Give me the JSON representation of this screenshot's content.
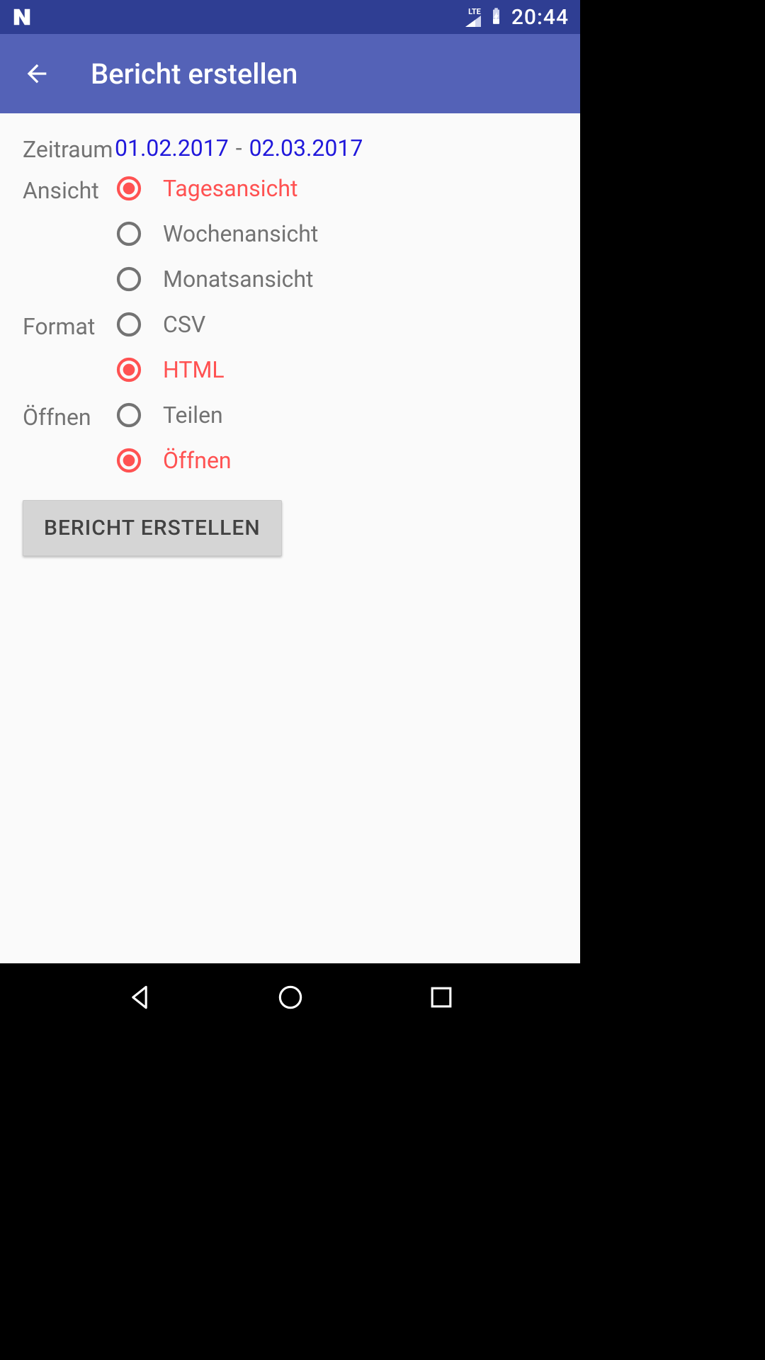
{
  "status": {
    "time": "20:44",
    "network_label": "LTE"
  },
  "appbar": {
    "title": "Bericht erstellen"
  },
  "form": {
    "zeitraum_label": "Zeitraum",
    "date_from": "01.02.2017",
    "date_sep": "-",
    "date_to": "02.03.2017",
    "ansicht_label": "Ansicht",
    "ansicht_options": {
      "tag": "Tagesansicht",
      "woche": "Wochenansicht",
      "monat": "Monatsansicht"
    },
    "ansicht_selected": "tag",
    "format_label": "Format",
    "format_options": {
      "csv": "CSV",
      "html": "HTML"
    },
    "format_selected": "html",
    "offnen_label": "Öffnen",
    "offnen_options": {
      "teilen": "Teilen",
      "offnen": "Öffnen"
    },
    "offnen_selected": "offnen",
    "submit_label": "BERICHT ERSTELLEN"
  },
  "colors": {
    "accent": "#ff5252",
    "link": "#2018db",
    "appbar_bg": "#5462b7",
    "status_bg": "#2f3e93"
  }
}
